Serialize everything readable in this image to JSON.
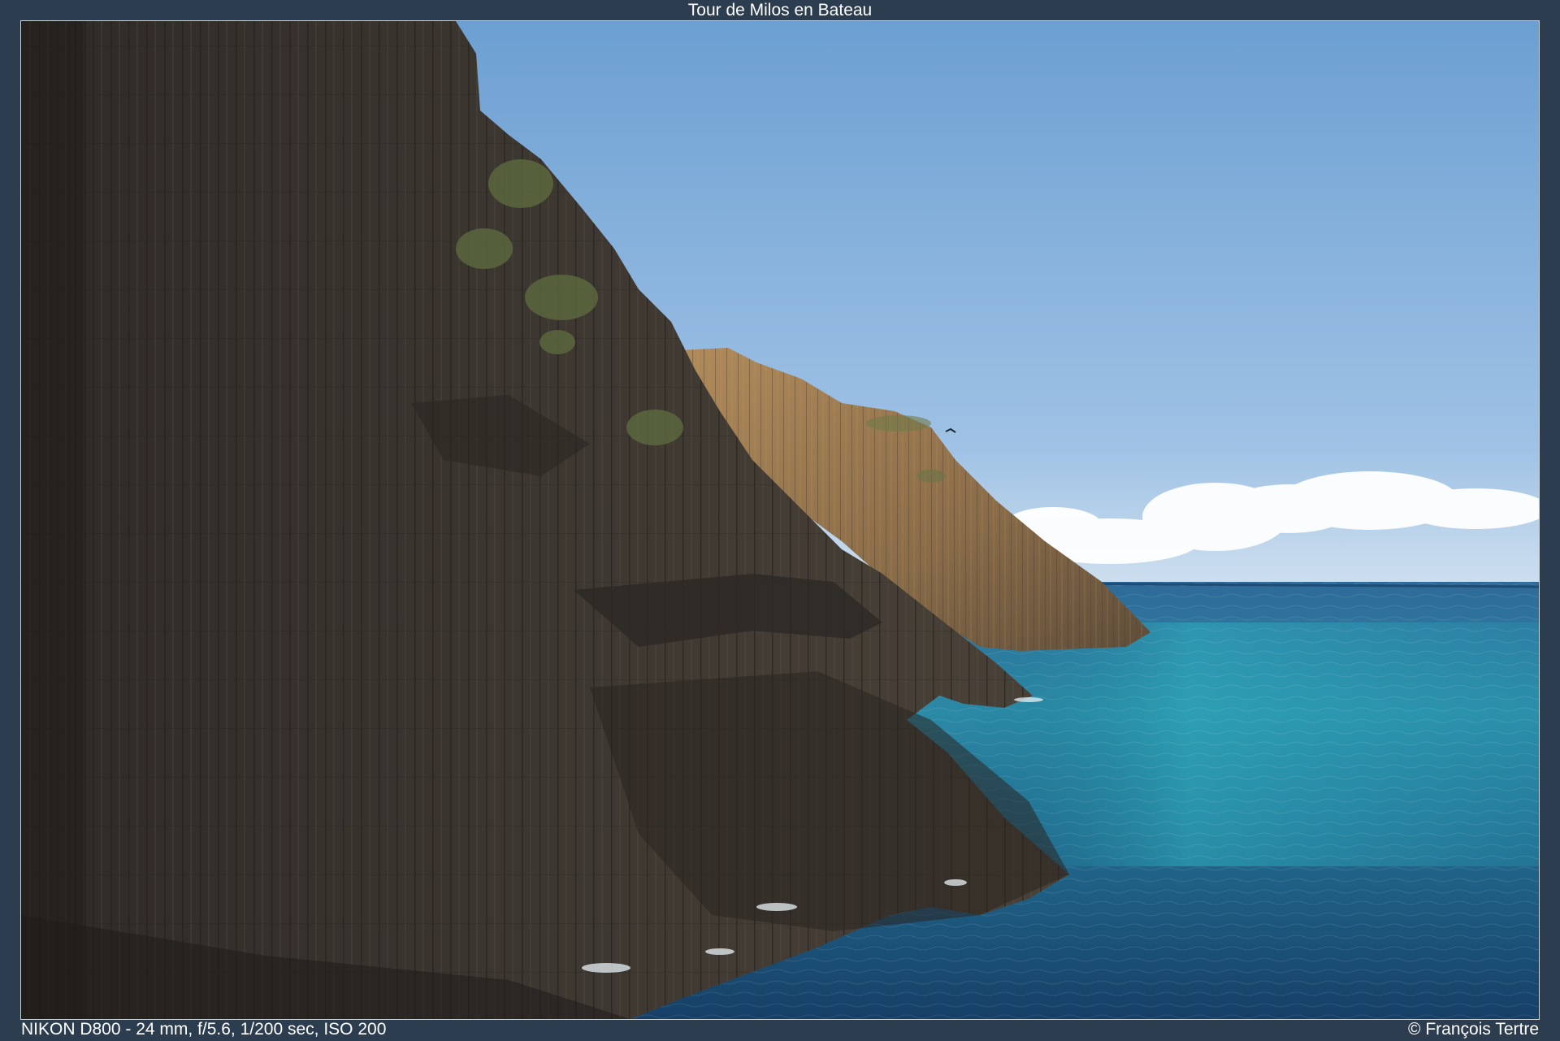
{
  "title": "Tour de Milos en Bateau",
  "photo": {
    "description_label": "Basalt column cliffs along the sea"
  },
  "footer": {
    "exif": "NIKON D800 - 24 mm, f/5.6, 1/200 sec, ISO 200",
    "credit": "© François Tertre"
  },
  "colors": {
    "sky_top": "#6a9fd3",
    "sky_horizon": "#c9dcef",
    "sea_far": "#2f6f9c",
    "sea_near": "#1e4f74",
    "sea_turquoise": "#2a9bb0",
    "rock_dark": "#3a342e",
    "rock_lit": "#9a7a52",
    "frame": "#2c3d50"
  }
}
